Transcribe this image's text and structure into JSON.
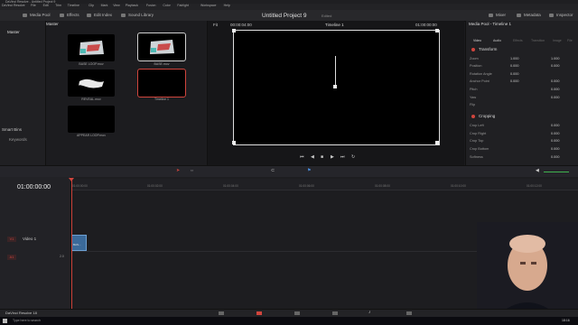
{
  "window": {
    "title": "DaVinci Resolve - Untitled Project 9"
  },
  "menu": [
    "DaVinci Resolve",
    "File",
    "Edit",
    "Trim",
    "Timeline",
    "Clip",
    "Mark",
    "View",
    "Playback",
    "Fusion",
    "Color",
    "Fairlight",
    "Workspace",
    "Help"
  ],
  "toolbar": {
    "media_pool": "Media Pool",
    "effects": "Effects",
    "edit_index": "Edit Index",
    "sound_library": "Sound Library",
    "project_title": "Untitled Project 9",
    "edited": "Edited",
    "mixer": "Mixer",
    "metadata": "Metadata",
    "inspector": "Inspector"
  },
  "left_panel": {
    "master": "Master",
    "smart_bins": "Smart Bins",
    "keywords": "Keywords"
  },
  "media_pool": {
    "header": "Master",
    "clips": [
      {
        "label": "BASE LOOP.mov"
      },
      {
        "label": "BASE.mov"
      },
      {
        "label": "REVEAL.mov"
      },
      {
        "label": "Timeline 1"
      },
      {
        "label": "APPEAR LOOP.mov"
      }
    ]
  },
  "viewer": {
    "zoom": "Fit",
    "timecode_left": "00:00:04:00",
    "timeline_name": "Timeline 1",
    "timecode_right": "01:00:00:00"
  },
  "inspector": {
    "header": "Media Pool - Timeline 1",
    "tabs": [
      "Video",
      "Audio",
      "Effects",
      "Transition",
      "Image",
      "File"
    ],
    "transform": "Transform",
    "rows": [
      {
        "label": "Zoom",
        "x": "1.000",
        "y": "1.000"
      },
      {
        "label": "Position",
        "x": "0.000",
        "y": "0.000"
      },
      {
        "label": "Rotation Angle",
        "x": "0.000"
      },
      {
        "label": "Anchor Point",
        "x": "0.000",
        "y": "0.000"
      },
      {
        "label": "Pitch",
        "x": "0.000"
      },
      {
        "label": "Yaw",
        "x": "0.000"
      },
      {
        "label": "Flip"
      }
    ],
    "cropping": "Cropping",
    "crop_rows": [
      {
        "label": "Crop Left",
        "x": "0.000"
      },
      {
        "label": "Crop Right",
        "x": "0.000"
      },
      {
        "label": "Crop Top",
        "x": "0.000"
      },
      {
        "label": "Crop Bottom",
        "x": "0.000"
      },
      {
        "label": "Softness",
        "x": "0.000"
      }
    ]
  },
  "timeline": {
    "timecode": "01:00:00:00",
    "ruler": [
      "01:00:00:00",
      "01:00:02:00",
      "01:00:04:00",
      "01:00:06:00",
      "01:00:08:00",
      "01:00:10:00",
      "01:00:12:00"
    ],
    "video_track": {
      "id": "V1",
      "name": "Video 1"
    },
    "audio_track": {
      "id": "A1",
      "level": "2.0"
    },
    "clip_label": "BAS..."
  },
  "app_badge": "DaVinci Resolve 18",
  "taskbar": {
    "search_placeholder": "Type here to search",
    "time": "18:16"
  },
  "colors": {
    "accent": "#d0453d",
    "clip": "#3b6a9a"
  }
}
